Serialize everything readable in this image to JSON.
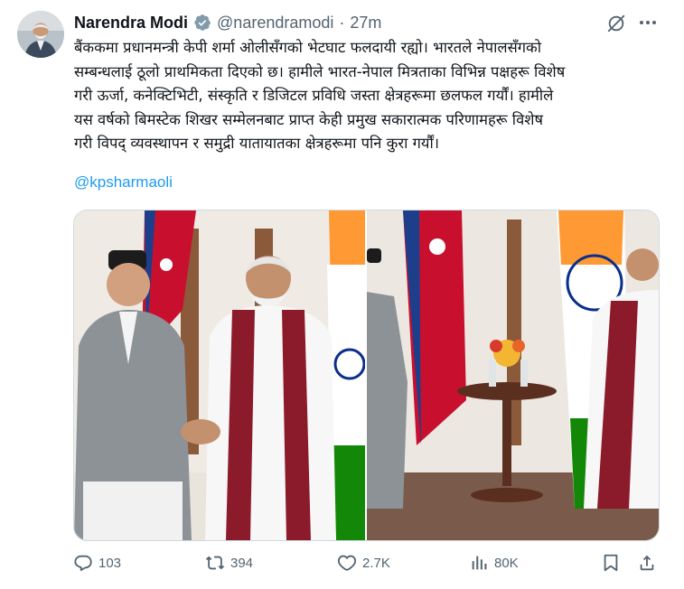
{
  "author": {
    "display_name": "Narendra Modi",
    "handle": "@narendramodi",
    "separator": "·",
    "time": "27m"
  },
  "icons": {
    "verified": "verified-badge-icon",
    "grok": "grok-icon",
    "more": "more-icon"
  },
  "tweet": {
    "lines": [
      "बैंककमा प्रधानमन्त्री केपी शर्मा ओलीसँगको भेटघाट फलदायी रह्यो। भारतले नेपालसँगको",
      "सम्बन्धलाई ठूलो प्राथमिकता दिएको छ। हामीले भारत-नेपाल मित्रताका विभिन्न पक्षहरू विशेष",
      "गरी ऊर्जा, कनेक्टिभिटी, संस्कृति र डिजिटल प्रविधि जस्ता क्षेत्रहरूमा छलफल गर्यौं। हामीले",
      "यस वर्षको बिमस्टेक शिखर सम्मेलनबाट प्राप्त केही प्रमुख सकारात्मक परिणामहरू विशेष",
      "गरी विपद् व्यवस्थापन र समुद्री यातायातका क्षेत्रहरूमा पनि कुरा गर्यौं।"
    ],
    "mention": "@kpsharmaoli"
  },
  "actions": {
    "replies": "103",
    "reposts": "394",
    "likes": "2.7K",
    "views": "80K"
  },
  "colors": {
    "accent": "#1d9bf0",
    "secondary_text": "#536471",
    "primary_text": "#0f1419"
  }
}
